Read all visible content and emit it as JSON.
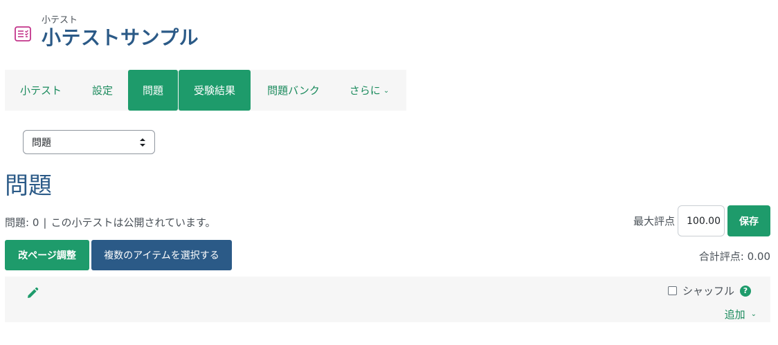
{
  "header": {
    "subtitle": "小テスト",
    "title": "小テストサンプル",
    "icon": "quiz-icon"
  },
  "tabs": [
    {
      "label": "小テスト",
      "active": false
    },
    {
      "label": "設定",
      "active": false
    },
    {
      "label": "問題",
      "active": true
    },
    {
      "label": "受験結果",
      "active": true
    },
    {
      "label": "問題バンク",
      "active": false
    },
    {
      "label": "さらに",
      "active": false
    }
  ],
  "select": {
    "value": "問題"
  },
  "page": {
    "heading": "問題",
    "question_count": "問題: 0",
    "separator": "|",
    "status_text": "この小テストは公開されています。"
  },
  "grading": {
    "max_grade_label": "最大評点",
    "max_grade_value": "100.00",
    "save_label": "保存",
    "total_label": "合計評点: 0.00"
  },
  "actions": {
    "repaginate_label": "改ページ調整",
    "select_multiple_label": "複数のアイテムを選択する"
  },
  "section": {
    "shuffle_label": "シャッフル",
    "help_symbol": "?",
    "add_label": "追加"
  },
  "colors": {
    "primary_green": "#1e9b6b",
    "primary_blue": "#2b5a87",
    "icon_pink": "#c2348a"
  }
}
